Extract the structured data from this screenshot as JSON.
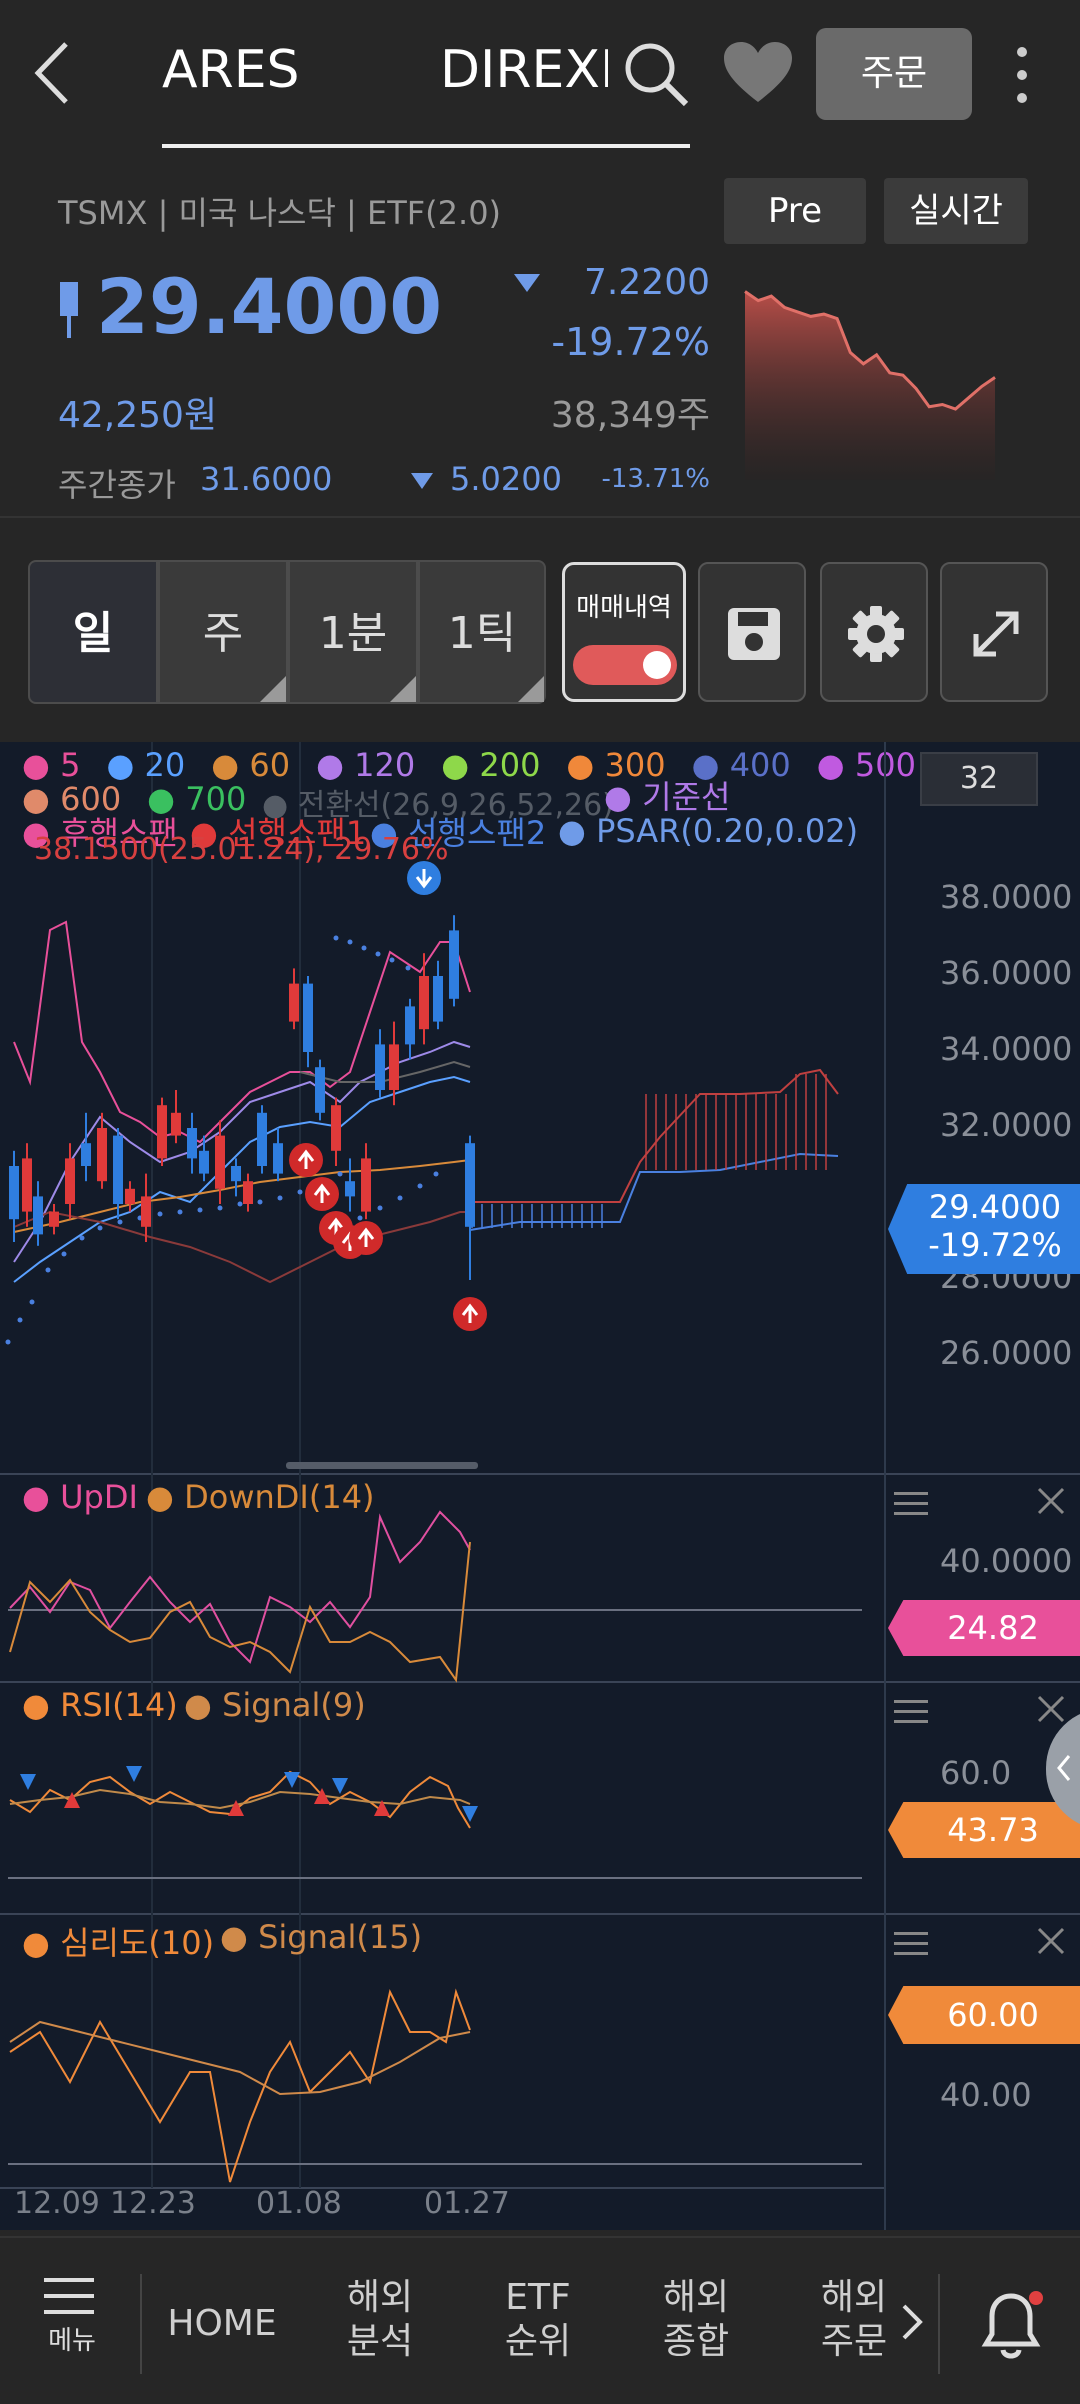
{
  "header": {
    "tab1": "ARES",
    "tab2": "DIREXION",
    "order_label": "주문"
  },
  "quote": {
    "subtitle": "TSMX | 미국 나스닥 | ETF(2.0)",
    "pre_label": "Pre",
    "realtime_label": "실시간",
    "price": "29.4000",
    "change": "7.2200",
    "change_pct": "-19.72%",
    "krw_price": "42,250원",
    "volume": "38,349주",
    "day_close_label": "주간종가",
    "day_close_value": "31.6000",
    "day_close_change": "5.0200",
    "day_close_pct": "-13.71%",
    "sparkline": [
      34.6,
      34.2,
      34.4,
      33.9,
      33.7,
      33.5,
      33.6,
      33.4,
      31.9,
      31.4,
      31.8,
      31.0,
      30.9,
      30.3,
      29.5,
      29.6,
      29.4,
      29.9,
      30.4,
      30.8
    ]
  },
  "toolbar": {
    "periods": [
      "일",
      "주",
      "1분",
      "1틱"
    ],
    "selected": "일",
    "trade_history_label": "매매내역",
    "trade_history_on": true
  },
  "chart_legend": {
    "ma": [
      {
        "label": "5",
        "color": "#e8509a"
      },
      {
        "label": "20",
        "color": "#5aa0ff"
      },
      {
        "label": "60",
        "color": "#d88a3a"
      },
      {
        "label": "120",
        "color": "#b07ae8"
      },
      {
        "label": "200",
        "color": "#8ed84a"
      },
      {
        "label": "300",
        "color": "#f0883a"
      },
      {
        "label": "400",
        "color": "#5a70c8"
      },
      {
        "label": "500",
        "color": "#c05ae0"
      },
      {
        "label": "600",
        "color": "#e08a6a"
      },
      {
        "label": "700",
        "color": "#3ac060"
      }
    ],
    "conversion": "전환선(26,9,26,52,26)",
    "base": "기준선",
    "lagging": "후행스팬",
    "lead1": "선행스팬1",
    "lead2": "선행스팬2",
    "psar": "PSAR(0.20,0.02)",
    "high_note": "38.1500(25.01.24), 29.76%"
  },
  "main_chart": {
    "count_box": "32",
    "y_labels": [
      "38.0000",
      "36.0000",
      "34.0000",
      "32.0000",
      "28.0000",
      "26.0000"
    ],
    "price_tag": "29.4000",
    "price_tag_pct": "-19.72%"
  },
  "dmi_panel": {
    "updi": "UpDI",
    "downdi": "DownDI(14)",
    "y_label": "40.0000",
    "tag": "24.82"
  },
  "rsi_panel": {
    "rsi": "RSI(14)",
    "signal": "Signal(9)",
    "y_label": "60.0",
    "tag": "43.73"
  },
  "psy_panel": {
    "psy": "심리도(10)",
    "signal": "Signal(15)",
    "y_label": "40.00",
    "tag": "60.00"
  },
  "x_labels": [
    "12.09",
    "12.23",
    "01.08",
    "01.27"
  ],
  "nav": {
    "menu": "메뉴",
    "home": "HOME",
    "item1a": "해외",
    "item1b": "분석",
    "item2a": "ETF",
    "item2b": "순위",
    "item3a": "해외",
    "item3b": "종합",
    "item4a": "해외",
    "item4b": "주문"
  },
  "colors": {
    "up": "#e03a3a",
    "down": "#2f7ee0",
    "accent_blue": "#6f9be8",
    "tag_pink": "#e8509a",
    "tag_orange": "#f08a3a"
  }
}
